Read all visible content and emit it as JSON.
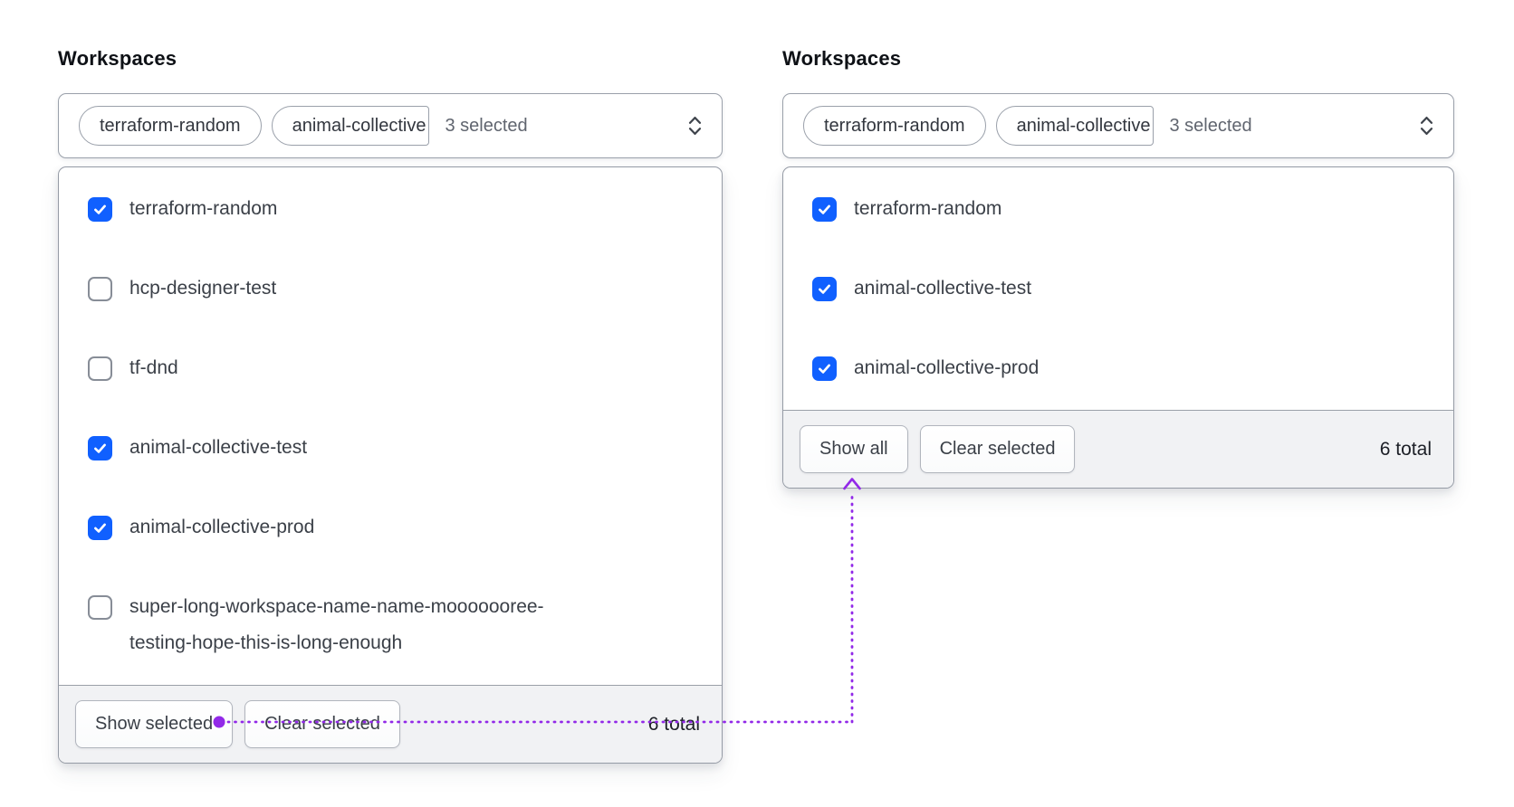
{
  "colors": {
    "checkbox_checked_blue": "#1060ff",
    "annotation_purple": "#9229e8"
  },
  "icons": {
    "trigger_caret": "chevron-up-down-icon",
    "checkbox_mark": "check-icon",
    "annotation_start": "dot-marker",
    "annotation_end": "arrow-up-icon"
  },
  "panels": [
    {
      "label": "Workspaces",
      "trigger": {
        "tags": [
          "terraform-random",
          "animal-collective"
        ],
        "summary": "3 selected"
      },
      "options": [
        {
          "label": "terraform-random",
          "checked": true
        },
        {
          "label": "hcp-designer-test",
          "checked": false
        },
        {
          "label": "tf-dnd",
          "checked": false
        },
        {
          "label": "animal-collective-test",
          "checked": true
        },
        {
          "label": "animal-collective-prod",
          "checked": true
        },
        {
          "label": "super-long-workspace-name-name-mooooooree-testing-hope-this-is-long-enough",
          "checked": false
        }
      ],
      "footer": {
        "primary_button": "Show selected",
        "secondary_button": "Clear selected",
        "total": "6 total"
      }
    },
    {
      "label": "Workspaces",
      "trigger": {
        "tags": [
          "terraform-random",
          "animal-collective"
        ],
        "summary": "3 selected"
      },
      "options": [
        {
          "label": "terraform-random",
          "checked": true
        },
        {
          "label": "animal-collective-test",
          "checked": true
        },
        {
          "label": "animal-collective-prod",
          "checked": true
        }
      ],
      "footer": {
        "primary_button": "Show all",
        "secondary_button": "Clear selected",
        "total": "6 total"
      }
    }
  ]
}
